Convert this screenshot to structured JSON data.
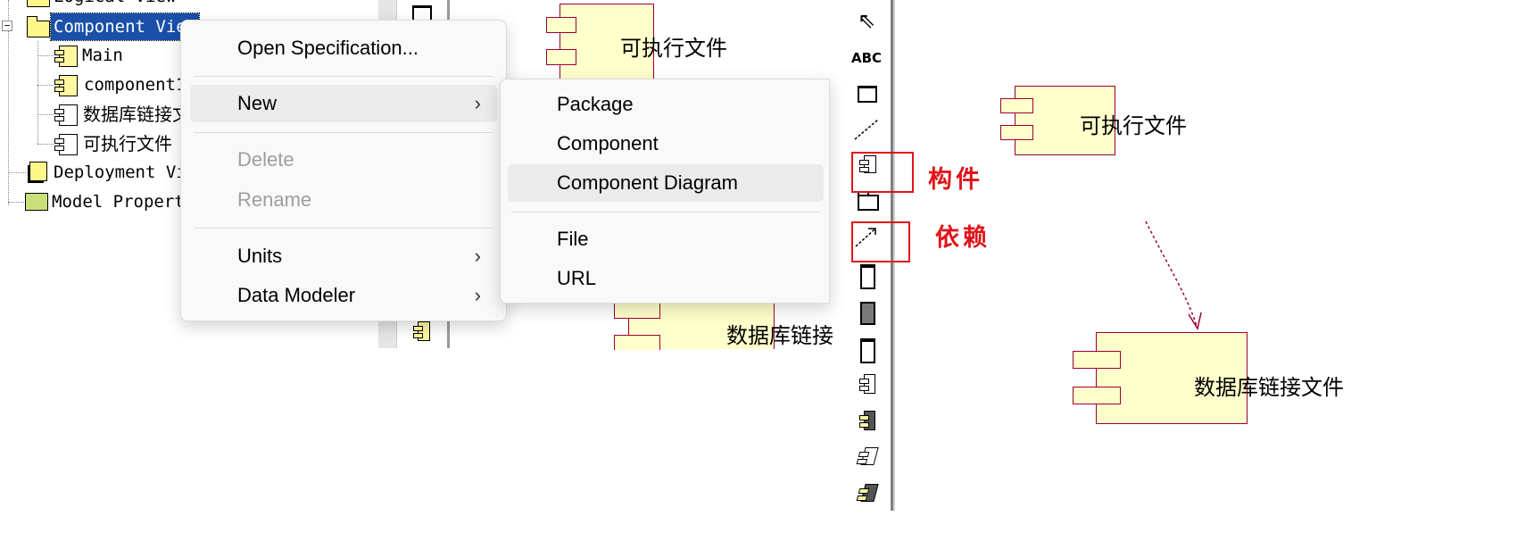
{
  "tree": {
    "items": [
      {
        "label": "Logical View",
        "icon": "folder-icon"
      },
      {
        "label": "Component View",
        "icon": "folder-icon",
        "selected": true
      },
      {
        "label": "Main",
        "icon": "component-icon"
      },
      {
        "label": "component1",
        "icon": "component-icon"
      },
      {
        "label": "数据库链接文",
        "icon": "component-icon"
      },
      {
        "label": "可执行文件",
        "icon": "component-icon"
      },
      {
        "label": "Deployment Vie",
        "icon": "deployment-icon"
      },
      {
        "label": "Model Properti",
        "icon": "model-properties-icon"
      }
    ]
  },
  "context_menu": {
    "items": [
      {
        "label": "Open Specification..."
      },
      {
        "label": "New",
        "submenu": true
      },
      {
        "label": "Delete",
        "disabled": true
      },
      {
        "label": "Rename",
        "disabled": true
      },
      {
        "label": "Units",
        "submenu": true
      },
      {
        "label": "Data Modeler",
        "submenu": true
      }
    ],
    "chevron": "›"
  },
  "submenu": {
    "items": [
      {
        "label": "Package"
      },
      {
        "label": "Component"
      },
      {
        "label": "Component Diagram"
      },
      {
        "label": "File"
      },
      {
        "label": "URL"
      }
    ]
  },
  "background_diagram": {
    "comp1_label": "可执行文件",
    "comp2_label": "数据库链接"
  },
  "toolbox": {
    "text_tool": "ABC",
    "annotations": {
      "component": "构件",
      "dependency": "依赖"
    }
  },
  "diagram": {
    "comp1_label": "可执行文件",
    "comp2_label": "数据库链接文件"
  },
  "colors": {
    "component_fill": "#ffffcc",
    "component_border": "#990033",
    "annotation_red": "#e0141a",
    "tree_selection": "#1a50a8"
  }
}
